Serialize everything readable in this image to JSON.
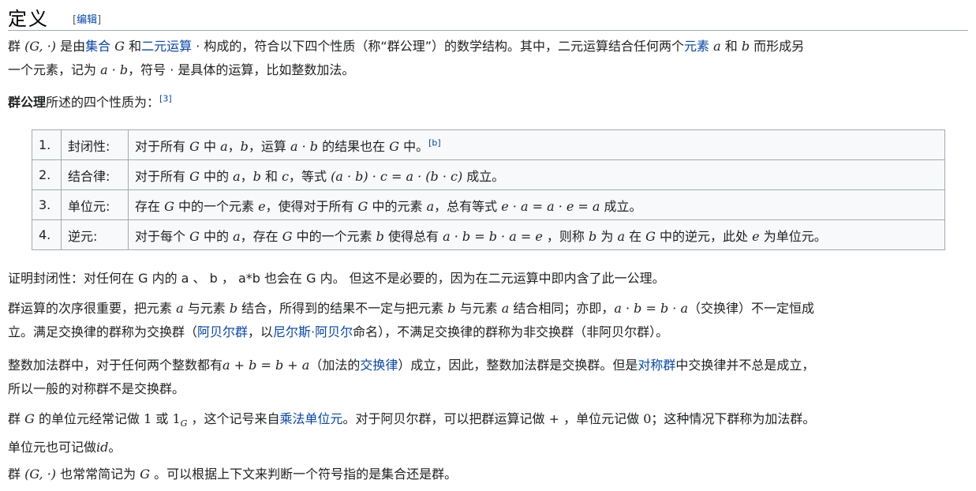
{
  "heading": {
    "title": "定义",
    "edit_open": "[",
    "edit_link": "编辑",
    "edit_close": "]"
  },
  "p1": {
    "a": "群 ",
    "m1": "(G, ·)",
    "b": " 是由",
    "link1": "集合",
    "m2": "G",
    "c": " 和",
    "link2": "二元运算",
    "d": " · 构成的，符合以下四个性质（称“群公理”）的数学结构。其中，二元运算结合任何两个",
    "link3": "元素",
    "m3": "a",
    "e": " 和 ",
    "m4": "b",
    "f": " 而形成另",
    "line2a": "一个元素，记为 ",
    "m5": "a · b",
    "line2b": "，符号 · 是具体的运算，比如整数加法。"
  },
  "p2": {
    "bold": "群公理",
    "text": "所述的四个性质为：",
    "ref": "[3]"
  },
  "axioms": [
    {
      "num": "1.",
      "name": "封闭性:",
      "parts": [
        [
          "t",
          "对于所有 "
        ],
        [
          "m",
          "G"
        ],
        [
          "t",
          " 中 "
        ],
        [
          "m",
          "a"
        ],
        [
          "t",
          "，"
        ],
        [
          "m",
          "b"
        ],
        [
          "t",
          "，运算 "
        ],
        [
          "m",
          "a · b"
        ],
        [
          "t",
          " 的结果也在 "
        ],
        [
          "m",
          "G"
        ],
        [
          "t",
          " 中。"
        ],
        [
          "s",
          "[b]"
        ]
      ]
    },
    {
      "num": "2.",
      "name": "结合律:",
      "parts": [
        [
          "t",
          "对于所有 "
        ],
        [
          "m",
          "G"
        ],
        [
          "t",
          " 中的 "
        ],
        [
          "m",
          "a"
        ],
        [
          "t",
          "，"
        ],
        [
          "m",
          "b"
        ],
        [
          "t",
          " 和 "
        ],
        [
          "m",
          "c"
        ],
        [
          "t",
          "，等式 "
        ],
        [
          "m",
          "(a · b) · c = a · (b · c)"
        ],
        [
          "t",
          " 成立。"
        ]
      ]
    },
    {
      "num": "3.",
      "name": "单位元:",
      "parts": [
        [
          "t",
          "存在 "
        ],
        [
          "m",
          "G"
        ],
        [
          "t",
          " 中的一个元素 "
        ],
        [
          "m",
          "e"
        ],
        [
          "t",
          "，使得对于所有 "
        ],
        [
          "m",
          "G"
        ],
        [
          "t",
          " 中的元素 "
        ],
        [
          "m",
          "a"
        ],
        [
          "t",
          "，总有等式 "
        ],
        [
          "m",
          "e · a = a · e = a"
        ],
        [
          "t",
          " 成立。"
        ]
      ]
    },
    {
      "num": "4.",
      "name": "逆元:",
      "parts": [
        [
          "t",
          "对于每个 "
        ],
        [
          "m",
          "G"
        ],
        [
          "t",
          " 中的 "
        ],
        [
          "m",
          "a"
        ],
        [
          "t",
          "，存在 "
        ],
        [
          "m",
          "G"
        ],
        [
          "t",
          " 中的一个元素 "
        ],
        [
          "m",
          "b"
        ],
        [
          "t",
          " 使得总有 "
        ],
        [
          "m",
          "a · b = b · a = e"
        ],
        [
          "t",
          " ，则称 "
        ],
        [
          "m",
          "b"
        ],
        [
          "t",
          " 为 "
        ],
        [
          "m",
          "a"
        ],
        [
          "t",
          " 在 "
        ],
        [
          "m",
          "G"
        ],
        [
          "t",
          " 中的逆元，此处 "
        ],
        [
          "m",
          "e"
        ],
        [
          "t",
          " 为单位元。"
        ]
      ]
    }
  ],
  "p3": {
    "text": "证明封闭性：对任何在 G 内的 a 、 b ， a*b 也会在 G 内。 但这不是必要的，因为在二元运算中即内含了此一公理。"
  },
  "p4": {
    "a": "群运算的次序很重要，把元素 ",
    "m1": "a",
    "b": " 与元素 ",
    "m2": "b",
    "c": " 结合，所得到的结果不一定与把元素 ",
    "m3": "b",
    "d": " 与元素 ",
    "m4": "a",
    "e": " 结合相同；亦即，",
    "m5": "a · b = b · a",
    "f": "（交换律）不一定恒成",
    "line2a": "立。满足交换律的群称为交换群（",
    "link1": "阿贝尔群",
    "line2b": "，以",
    "link2": "尼尔斯·阿贝尔",
    "line2c": "命名），不满足交换律的群称为非交换群（非阿贝尔群）。"
  },
  "p5": {
    "a": "整数加法群中，对于任何两个整数都有",
    "m1": "a + b = b + a",
    "b": "（加法的",
    "link1": "交换律",
    "c": "）成立，因此，整数加法群是交换群。但是",
    "link2": "对称群",
    "d": "中交换律并不总是成立，",
    "line2": "所以一般的对称群不是交换群。"
  },
  "p6": {
    "a": "群 ",
    "m1": "G",
    "b": " 的单位元经常记做 ",
    "m2": "1",
    "c": " 或 ",
    "m3": "1",
    "m3sub": "G",
    "d": " ，这个记号来自",
    "link1": "乘法单位元",
    "e": "。对于阿贝尔群，可以把群运算记做 ",
    "m4": "+",
    "f": " ，单位元记做 ",
    "m5": "0",
    "g": "；这种情况下群称为加法群。",
    "line2a": "单位元也可记做",
    "m6": "id",
    "line2b": "。"
  },
  "p7": {
    "a": "群 ",
    "m1": "(G, ·)",
    "b": " 也常常简记为 ",
    "m2": "G",
    "c": " 。可以根据上下文来判断一个符号指的是集合还是群。"
  }
}
